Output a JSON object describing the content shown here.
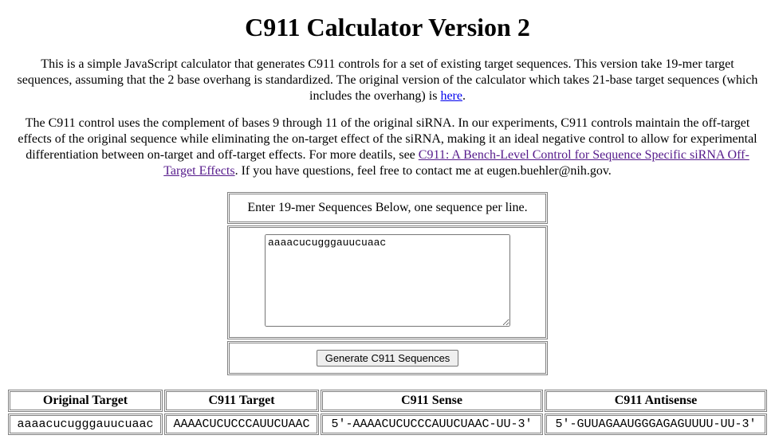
{
  "title": "C911 Calculator Version 2",
  "intro1_a": "This is a simple JavaScript calculator that generates C911 controls for a set of existing target sequences. This version take 19-mer target sequences, assuming that the 2 base overhang is standardized. The original version of the calculator which takes 21-base target sequences (which includes the overhang) is ",
  "intro1_link": "here",
  "intro1_b": ".",
  "intro2_a": "The C911 control uses the complement of bases 9 through 11 of the original siRNA. In our experiments, C911 controls maintain the off-target effects of the original sequence while eliminating the on-target effect of the siRNA, making it an ideal negative control to allow for experimental differentiation between on-target and off-target effects. For more deatils, see ",
  "intro2_link": "C911: A Bench-Level Control for Sequence Specific siRNA Off-Target Effects",
  "intro2_b": ". If you have questions, feel free to contact me at eugen.buehler@nih.gov.",
  "form": {
    "header": "Enter 19-mer Sequences Below, one sequence per line.",
    "textarea_value": "aaaacucugggauucuaac",
    "button_label": "Generate C911 Sequences"
  },
  "results": {
    "headers": [
      "Original Target",
      "C911 Target",
      "C911 Sense",
      "C911 Antisense"
    ],
    "rows": [
      [
        "aaaacucugggauucuaac",
        "AAAACUCUCCCAUUCUAAC",
        "5'-AAAACUCUCCCAUUCUAAC-UU-3'",
        "5'-GUUAGAAUGGGAGAGUUUU-UU-3'"
      ]
    ]
  }
}
